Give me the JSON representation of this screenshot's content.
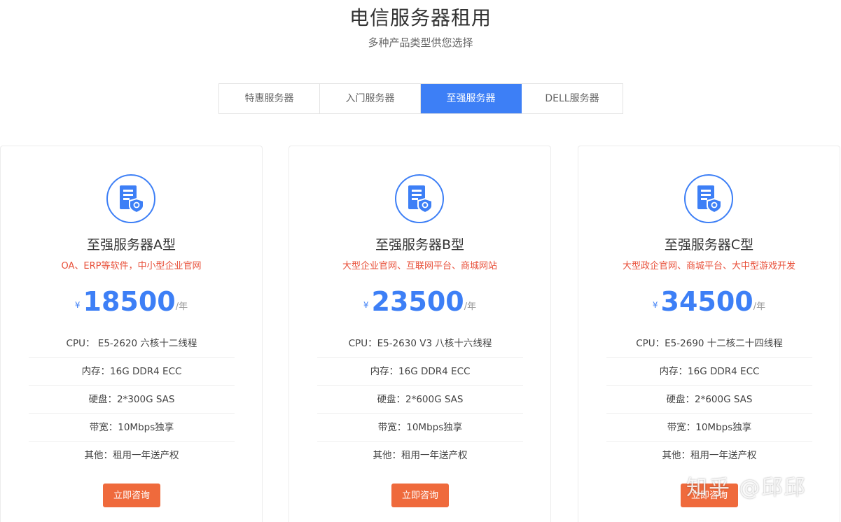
{
  "header": {
    "title": "电信服务器租用",
    "subtitle": "多种产品类型供您选择"
  },
  "tabs": [
    {
      "label": "特惠服务器",
      "active": false
    },
    {
      "label": "入门服务器",
      "active": false
    },
    {
      "label": "至强服务器",
      "active": true
    },
    {
      "label": "DELL服务器",
      "active": false
    }
  ],
  "colors": {
    "accent": "#3d7ff6",
    "button": "#ef6a3c",
    "desc": "#e8503a"
  },
  "cards": [
    {
      "icon": "server-shield-icon",
      "name": "至强服务器A型",
      "desc": "OA、ERP等软件，中小型企业官网",
      "currency": "¥",
      "price": "18500",
      "unit": "/年",
      "specs": [
        "CPU： E5-2620 六核十二线程",
        "内存：16G DDR4 ECC",
        "硬盘：2*300G SAS",
        "带宽：10Mbps独享",
        "其他：租用一年送产权"
      ],
      "button": "立即咨询"
    },
    {
      "icon": "server-shield-icon",
      "name": "至强服务器B型",
      "desc": "大型企业官网、互联网平台、商城网站",
      "currency": "¥",
      "price": "23500",
      "unit": "/年",
      "specs": [
        "CPU：E5-2630 V3 八核十六线程",
        "内存：16G DDR4 ECC",
        "硬盘：2*600G SAS",
        "带宽：10Mbps独享",
        "其他：租用一年送产权"
      ],
      "button": "立即咨询"
    },
    {
      "icon": "server-shield-icon",
      "name": "至强服务器C型",
      "desc": "大型政企官网、商城平台、大中型游戏开发",
      "currency": "¥",
      "price": "34500",
      "unit": "/年",
      "specs": [
        "CPU：E5-2690 十二核二十四线程",
        "内存：16G DDR4 ECC",
        "硬盘：2*600G SAS",
        "带宽：10Mbps独享",
        "其他：租用一年送产权"
      ],
      "button": "立即咨询"
    }
  ],
  "watermark": "知乎 @邱邱"
}
